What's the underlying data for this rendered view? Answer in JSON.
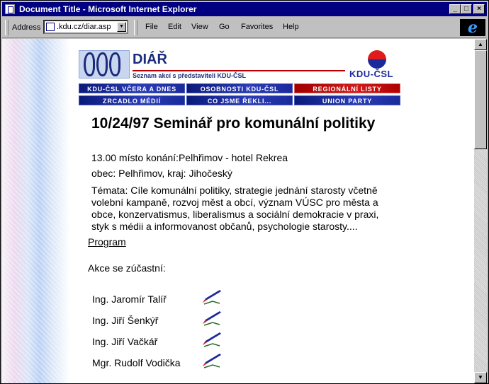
{
  "window": {
    "title": "Document Title - Microsoft Internet Explorer"
  },
  "toolbar": {
    "address_label": "Address",
    "address_value": ".kdu.cz/diar.asp",
    "menu": [
      "File",
      "Edit",
      "View",
      "Go",
      "Favorites",
      "Help"
    ],
    "logo_glyph": "e"
  },
  "banner": {
    "title": "DIÁŘ",
    "subtitle": "Seznam akcí s představiteli KDU-ČSL",
    "party": "KDU-ČSL",
    "nav": [
      "KDU-ČSL VČERA A DNES",
      "OSOBNOSTI KDU-ČSL",
      "REGIONÁLNÍ LISTY",
      "ZRCADLO MÉDIÍ",
      "CO JSME ŘEKLI...",
      "UNION PARTY"
    ]
  },
  "event": {
    "heading": "10/24/97 Seminář pro komunální politiky",
    "place": "13.00 místo konání:Pelhřimov - hotel Rekrea",
    "region": "obec: Pelhřimov, kraj: Jihočeský",
    "topics_lines": [
      "Témata: Cíle komunální politiky, strategie jednání starosty včetně",
      "volební kampaně, rozvoj měst a obcí, význam VÚSC pro města a",
      "obce, konzervatismus, liberalismus a sociální demokracie v praxi,",
      "styk s médii a informovanost občanů, psychologie starosty...."
    ],
    "program_link": "Program",
    "participants_label": "Akce se zúčastní:",
    "participants": [
      "Ing. Jaromír  Talíř",
      "Ing. Jiří  Šenkýř",
      "Ing. Jiří  Vačkář",
      "Mgr. Rudolf  Vodička"
    ]
  },
  "colors": {
    "titlebar": "#000080",
    "nav_blue": "#1b2a9a",
    "nav_red": "#c00000"
  }
}
